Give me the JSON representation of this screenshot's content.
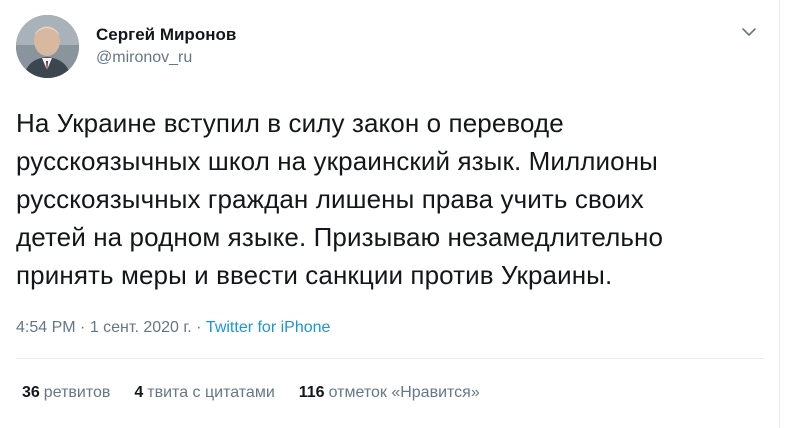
{
  "author": {
    "display_name": "Сергей Миронов",
    "handle": "@mironov_ru",
    "avatar_icon": "user-avatar"
  },
  "menu": {
    "icon": "chevron-down-icon"
  },
  "tweet": {
    "text": "На Украине вступил в силу закон о переводе\nрусскоязычных школ на украинский язык. Миллионы\nрусскоязычных граждан лишены права учить своих\nдетей на родном языке. Призываю незамедлительно\nпринять меры и ввести санкции против Украины."
  },
  "meta": {
    "time": "4:54 PM",
    "separator1": " · ",
    "date": "1 сент. 2020 г.",
    "separator2": " · ",
    "source": "Twitter for iPhone"
  },
  "stats": {
    "retweets_count": "36",
    "retweets_label": "ретвитов",
    "quotes_count": "4",
    "quotes_label": "твита с цитатами",
    "likes_count": "116",
    "likes_label": "отметок «Нравится»"
  },
  "colors": {
    "link": "#1b95e0",
    "secondary_text": "#657786",
    "primary_text": "#14171a",
    "divider": "#e6ecf0"
  }
}
